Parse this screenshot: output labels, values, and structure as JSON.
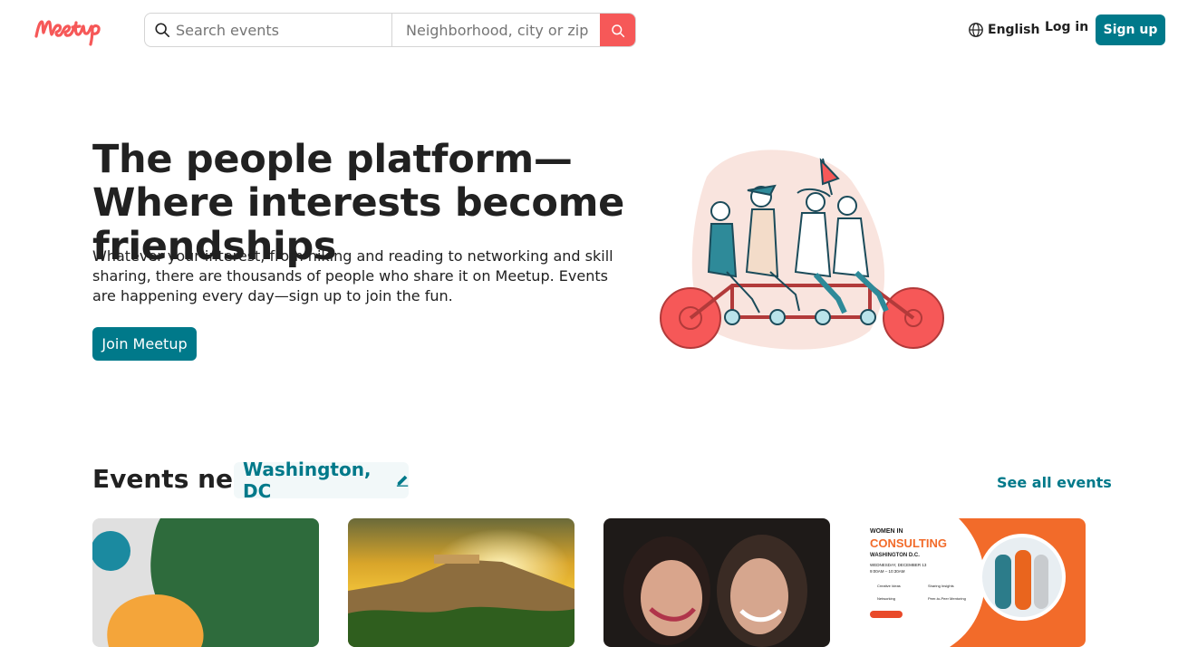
{
  "header": {
    "search_placeholder": "Search events",
    "location_placeholder": "Neighborhood, city or zip",
    "language": "English",
    "login": "Log in",
    "signup": "Sign up"
  },
  "hero": {
    "title": "The people platform—Where interests become friendships",
    "description": "Whatever your interest, from hiking and reading to networking and skill sharing, there are thousands of people who share it on Meetup. Events are happening every day—sign up to join the fun.",
    "cta": "Join Meetup"
  },
  "events": {
    "heading": "Events near",
    "location": "Washington, DC",
    "see_all": "See all events",
    "card4": {
      "line1": "WOMEN IN",
      "line2": "CONSULTING",
      "line3": "WASHINGTON D.C.",
      "date": "WEDNESDAY, DECEMBER 13",
      "time": "9:00AM – 10:30AM",
      "item1": "Creative Ideas",
      "item2": "Sharing Insights",
      "item3": "Networking",
      "item4": "Peer-to-Peer Mentoring"
    }
  },
  "colors": {
    "brand_red": "#f65858",
    "teal": "#00798a"
  }
}
